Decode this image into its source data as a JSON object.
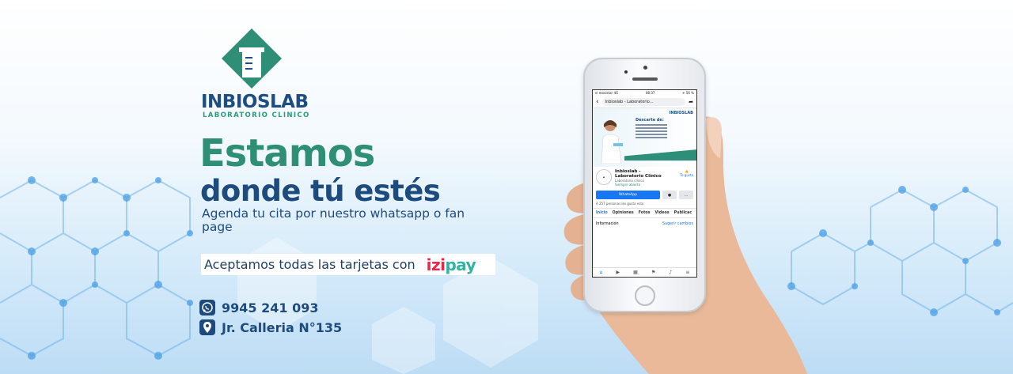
{
  "brand": {
    "name": "INBIOSLAB",
    "subtitle": "LABORATORIO CLINICO"
  },
  "headline": {
    "line1": "Estamos",
    "line2": "donde tú estés"
  },
  "subtitle": "Agenda tu cita por nuestro whatsapp o fan page",
  "cards": {
    "text": "Aceptamos todas las tarjetas con",
    "logo_part1": "izi",
    "logo_part2": "pay"
  },
  "contact": {
    "phone": "9945 241 093",
    "address": "Jr. Calleria N°135"
  },
  "colors": {
    "green": "#2e8f76",
    "navy": "#1e4b7e",
    "izi_red": "#e6284a",
    "izi_teal": "#2fb5a0"
  },
  "icons": [
    "lab-beaker-logo",
    "whatsapp-icon",
    "location-pin-icon"
  ],
  "phone_screen": {
    "status_left": "ııl movistar 4G",
    "status_time": "08:37",
    "status_right": "✈ 56 %",
    "search": "Inbioslab - Laboratorio...",
    "cover_brand": "INBIOSLAB",
    "cover_title": "Descarte de:",
    "page_name": "Inbioslab - Laboratorio Clínico",
    "page_category": "Laboratorio clínico",
    "page_open": "Siempre abierto",
    "like_label": "Te gusta",
    "whatsapp_button": "WhatsApp",
    "likes_count": "A 257 personas les gusta esto",
    "tabs": [
      "Inicio",
      "Opiniones",
      "Fotos",
      "Videos",
      "Publicac"
    ],
    "info_label": "Información",
    "suggest_label": "Sugerir cambios"
  }
}
